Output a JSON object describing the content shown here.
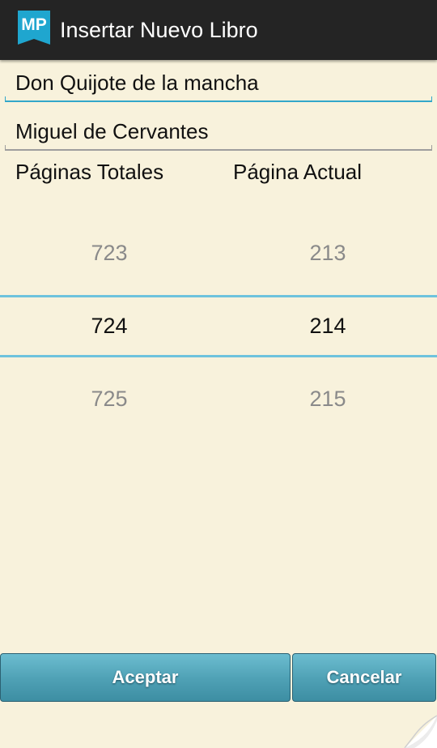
{
  "action_bar": {
    "logo_text": "MP",
    "title": "Insertar Nuevo Libro"
  },
  "form": {
    "title_value": "Don Quijote de la mancha",
    "author_value": "Miguel de Cervantes"
  },
  "pickers": {
    "total_pages": {
      "label": "Páginas Totales",
      "prev": "723",
      "current": "724",
      "next": "725"
    },
    "current_page": {
      "label": "Página Actual",
      "prev": "213",
      "current": "214",
      "next": "215"
    }
  },
  "buttons": {
    "accept": "Aceptar",
    "cancel": "Cancelar"
  },
  "colors": {
    "background": "#f8f2dc",
    "action_bar": "#242424",
    "accent": "#33a7c9",
    "button": "#4ea0b4"
  },
  "icons": {
    "app_logo": "mp-logo-icon",
    "page_curl": "page-curl-icon"
  }
}
